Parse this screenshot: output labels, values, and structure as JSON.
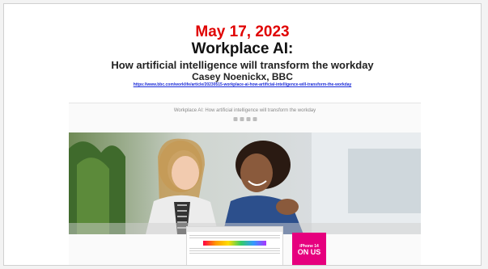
{
  "slide": {
    "date": "May 17, 2023",
    "title": "Workplace AI:",
    "subtitle": "How artificial intelligence will transform the workday",
    "author": "Casey Noenickx, BBC",
    "url": "https://www.bbc.com/worklife/article/20230515-workplace-ai-how-artificial-intelligence-will-transform-the-workday"
  },
  "screenshot": {
    "headline": "Workplace AI: How artificial intelligence will transform the workday",
    "ad_phone": "iPhone 14",
    "ad_onus": "ON US"
  },
  "colors": {
    "date": "#e00000",
    "link": "#1a2bd8",
    "ad": "#e6007e"
  }
}
